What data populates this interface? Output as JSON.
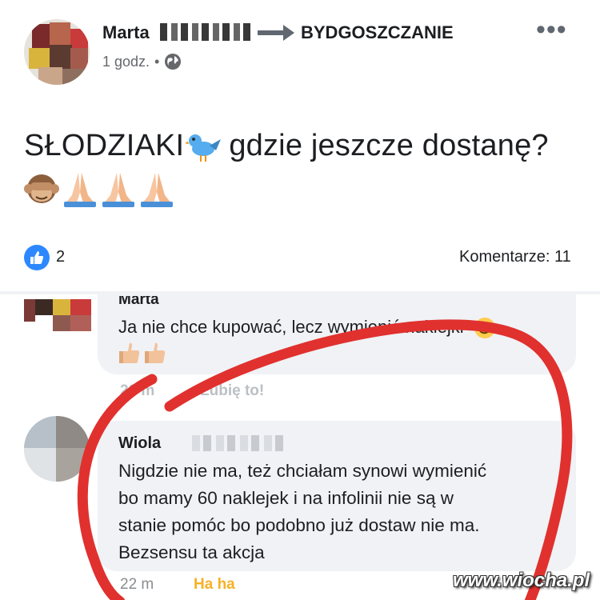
{
  "post": {
    "author": "Marta",
    "group": "BYDGOSZCZANIE",
    "time": "1 godz.",
    "separator": "•",
    "text": "SŁODZIAKI",
    "text_rest": "gdzie jeszcze dostanę?",
    "icons": [
      "bird-emoji",
      "see-no-evil-monkey-emoji",
      "folded-hands-emoji",
      "folded-hands-emoji",
      "folded-hands-emoji"
    ]
  },
  "reactions": {
    "like_count": "2",
    "comments_label": "Komentarze: 11"
  },
  "comments": [
    {
      "name": "Marta",
      "text": "Ja nie chce kupować, lecz wymienić naklejki",
      "time": "20 m",
      "action": "Lubię to!"
    },
    {
      "name": "Wiola",
      "text": "Nigdzie nie ma, też chciałam synowi wymienić\nbo mamy 60 naklejek i na infolinii nie są w\nstanie pomóc bo podobno już dostaw nie ma.\nBezsensu ta akcja",
      "time": "22 m",
      "action": "Ha ha"
    }
  ],
  "watermark": "www.wiocha.pl",
  "colors": {
    "like_blue": "#2d88ff",
    "bubble": "#f0f2f5",
    "haha_orange": "#f7b125",
    "marker_red": "#e0312f"
  }
}
